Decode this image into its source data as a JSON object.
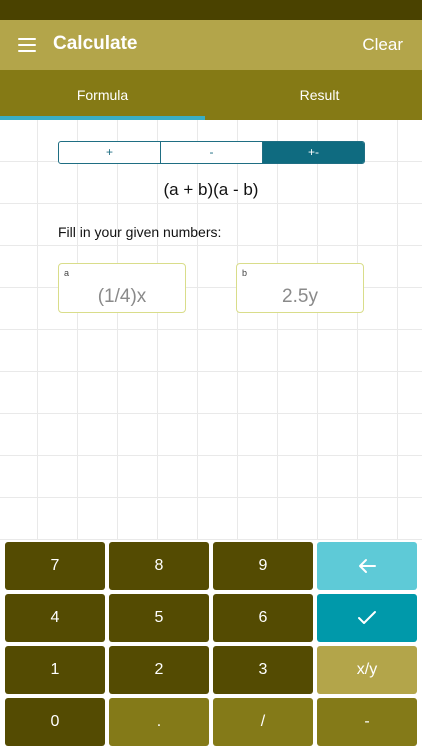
{
  "app": {
    "title": "Calculate",
    "clear_label": "Clear"
  },
  "tabs": [
    {
      "label": "Formula"
    },
    {
      "label": "Result"
    }
  ],
  "operations": [
    {
      "label": "+"
    },
    {
      "label": "-"
    },
    {
      "label": "+-"
    }
  ],
  "selected_operation": "+-",
  "formula": "(a + b)(a - b)",
  "instruction": "Fill in your given numbers:",
  "inputs": {
    "a": {
      "label": "a",
      "value": "(1/4)x"
    },
    "b": {
      "label": "b",
      "value": "2.5y"
    }
  },
  "keypad": {
    "k7": "7",
    "k8": "8",
    "k9": "9",
    "k4": "4",
    "k5": "5",
    "k6": "6",
    "k1": "1",
    "k2": "2",
    "k3": "3",
    "k0": "0",
    "dot": ".",
    "slash": "/",
    "frac": "x/y",
    "minus": "-"
  },
  "colors": {
    "status_bar": "#4a4200",
    "app_bar": "#b3a54a",
    "tab_bar": "#857a15",
    "tab_indicator": "#3aaec5",
    "key_dark": "#544b02",
    "key_mid": "#847a18",
    "key_light": "#b3a54a",
    "key_backspace": "#5ecad7",
    "key_confirm": "#0099aa"
  },
  "icons": {
    "menu": "hamburger-icon",
    "backspace": "arrow-left-icon",
    "confirm": "checkmark-icon"
  }
}
